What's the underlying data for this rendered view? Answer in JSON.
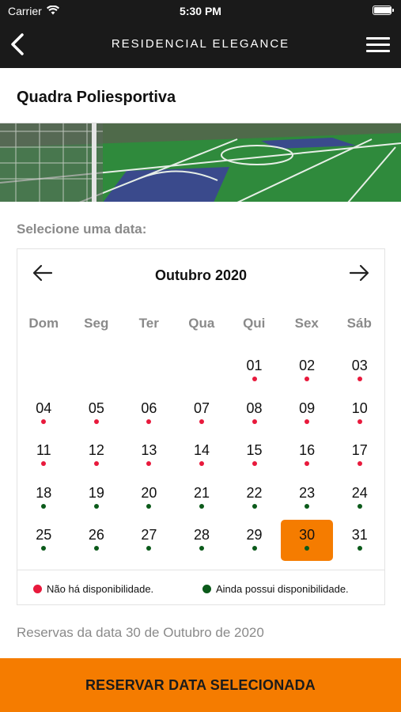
{
  "status_bar": {
    "carrier": "Carrier",
    "time": "5:30 PM",
    "battery_level": 1.0
  },
  "nav": {
    "title": "RESIDENCIAL ELEGANCE",
    "back_icon": "chevron-left-icon",
    "menu_icon": "hamburger-menu-icon"
  },
  "page": {
    "title": "Quadra Poliesportiva",
    "select_label": "Selecione uma data:"
  },
  "calendar": {
    "month_label": "Outubro 2020",
    "prev_icon": "arrow-left-icon",
    "next_icon": "arrow-right-icon",
    "weekdays": [
      "Dom",
      "Seg",
      "Ter",
      "Qua",
      "Qui",
      "Sex",
      "Sáb"
    ],
    "leading_blanks": 4,
    "selected_day": "30",
    "days": [
      {
        "label": "01",
        "status": "unavailable"
      },
      {
        "label": "02",
        "status": "unavailable"
      },
      {
        "label": "03",
        "status": "unavailable"
      },
      {
        "label": "04",
        "status": "unavailable"
      },
      {
        "label": "05",
        "status": "unavailable"
      },
      {
        "label": "06",
        "status": "unavailable"
      },
      {
        "label": "07",
        "status": "unavailable"
      },
      {
        "label": "08",
        "status": "unavailable"
      },
      {
        "label": "09",
        "status": "unavailable"
      },
      {
        "label": "10",
        "status": "unavailable"
      },
      {
        "label": "11",
        "status": "unavailable"
      },
      {
        "label": "12",
        "status": "unavailable"
      },
      {
        "label": "13",
        "status": "unavailable"
      },
      {
        "label": "14",
        "status": "unavailable"
      },
      {
        "label": "15",
        "status": "unavailable"
      },
      {
        "label": "16",
        "status": "unavailable"
      },
      {
        "label": "17",
        "status": "unavailable"
      },
      {
        "label": "18",
        "status": "available"
      },
      {
        "label": "19",
        "status": "available"
      },
      {
        "label": "20",
        "status": "available"
      },
      {
        "label": "21",
        "status": "available"
      },
      {
        "label": "22",
        "status": "available"
      },
      {
        "label": "23",
        "status": "available"
      },
      {
        "label": "24",
        "status": "available"
      },
      {
        "label": "25",
        "status": "available"
      },
      {
        "label": "26",
        "status": "available"
      },
      {
        "label": "27",
        "status": "available"
      },
      {
        "label": "28",
        "status": "available"
      },
      {
        "label": "29",
        "status": "available"
      },
      {
        "label": "30",
        "status": "available"
      },
      {
        "label": "31",
        "status": "available"
      }
    ]
  },
  "legend": {
    "unavailable_label": "Não há disponibilidade.",
    "available_label": "Ainda possui disponibilidade."
  },
  "colors": {
    "unavailable": "#e8193c",
    "available": "#0b5a1a",
    "accent": "#f57c00",
    "header_bg": "#1a1a1a"
  },
  "reservations": {
    "label": "Reservas da data 30 de Outubro de 2020"
  },
  "action": {
    "reserve_label": "RESERVAR DATA SELECIONADA"
  }
}
